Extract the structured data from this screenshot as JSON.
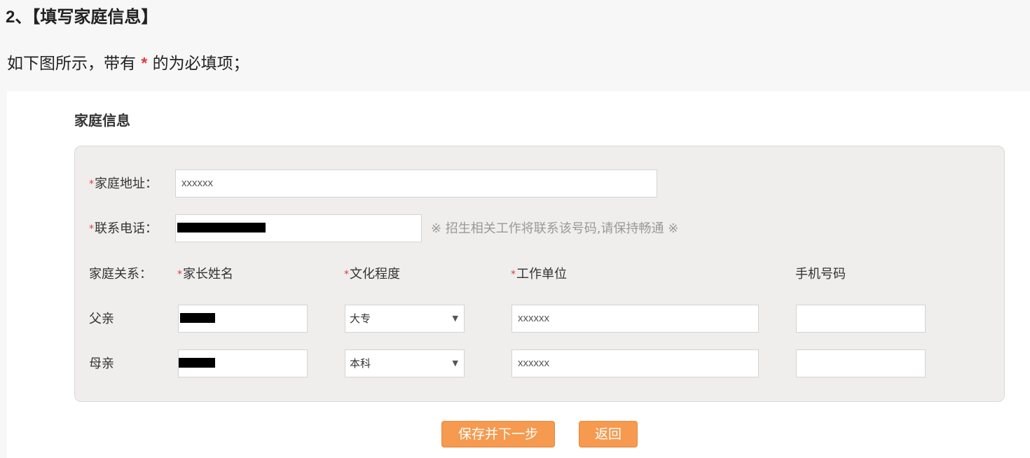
{
  "doc": {
    "heading_num": "2",
    "heading_text": "、【填写家庭信息】",
    "para_before": "如下图所示，带有",
    "para_star": "*",
    "para_after": "的为必填项；"
  },
  "form": {
    "section_title": "家庭信息",
    "required_mark": "*",
    "address": {
      "label": "家庭地址：",
      "value": "xxxxxx"
    },
    "phone": {
      "label": "联系电话：",
      "value": "",
      "hint": "※ 招生相关工作将联系该号码,请保持畅通 ※"
    },
    "relations": {
      "label": "家庭关系：",
      "columns": {
        "parent_name": "家长姓名",
        "education": "文化程度",
        "work_unit": "工作单位",
        "mobile": "手机号码"
      },
      "rows": [
        {
          "relation": "父亲",
          "name": "",
          "education": "大专",
          "work_unit": "xxxxxx",
          "mobile": ""
        },
        {
          "relation": "母亲",
          "name": "",
          "education": "本科",
          "work_unit": "xxxxxx",
          "mobile": ""
        }
      ]
    }
  },
  "buttons": {
    "save_next": "保存并下一步",
    "back": "返回"
  },
  "icons": {
    "dropdown": "triangle-down"
  },
  "colors": {
    "required": "#e4393c",
    "button": "#f59a4f",
    "form_bg": "#efeeed"
  }
}
